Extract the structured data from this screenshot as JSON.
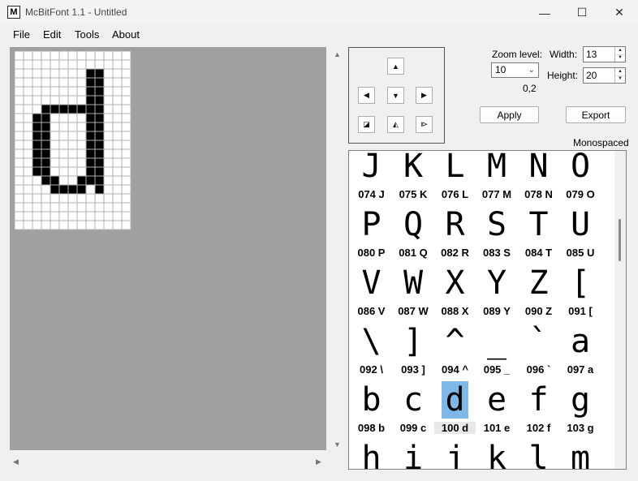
{
  "window": {
    "title": "McBitFont 1.1 - Untitled",
    "app_icon_letter": "M",
    "minimize": "—",
    "maximize": "☐",
    "close": "✕"
  },
  "menu": [
    "File",
    "Edit",
    "Tools",
    "About"
  ],
  "editor": {
    "grid_cols": 13,
    "grid_rows": 20,
    "filled_pixels": [
      [
        8,
        2
      ],
      [
        9,
        2
      ],
      [
        8,
        3
      ],
      [
        9,
        3
      ],
      [
        8,
        4
      ],
      [
        9,
        4
      ],
      [
        8,
        5
      ],
      [
        9,
        5
      ],
      [
        8,
        6
      ],
      [
        9,
        6
      ],
      [
        3,
        6
      ],
      [
        4,
        6
      ],
      [
        5,
        6
      ],
      [
        6,
        6
      ],
      [
        7,
        6
      ],
      [
        2,
        7
      ],
      [
        3,
        7
      ],
      [
        8,
        7
      ],
      [
        9,
        7
      ],
      [
        2,
        8
      ],
      [
        3,
        8
      ],
      [
        8,
        8
      ],
      [
        9,
        8
      ],
      [
        2,
        9
      ],
      [
        3,
        9
      ],
      [
        8,
        9
      ],
      [
        9,
        9
      ],
      [
        2,
        10
      ],
      [
        3,
        10
      ],
      [
        8,
        10
      ],
      [
        9,
        10
      ],
      [
        2,
        11
      ],
      [
        3,
        11
      ],
      [
        8,
        11
      ],
      [
        9,
        11
      ],
      [
        2,
        12
      ],
      [
        3,
        12
      ],
      [
        8,
        12
      ],
      [
        9,
        12
      ],
      [
        2,
        13
      ],
      [
        3,
        13
      ],
      [
        8,
        13
      ],
      [
        9,
        13
      ],
      [
        3,
        14
      ],
      [
        4,
        14
      ],
      [
        7,
        14
      ],
      [
        8,
        14
      ],
      [
        9,
        14
      ],
      [
        4,
        15
      ],
      [
        5,
        15
      ],
      [
        6,
        15
      ],
      [
        7,
        15
      ],
      [
        9,
        15
      ]
    ],
    "colors": {
      "canvas_bg": "#a0a0a0",
      "pixel_on": "#000000",
      "pixel_off": "#ffffff"
    }
  },
  "controls": {
    "zoom_label": "Zoom level:",
    "zoom_value": "10",
    "coords": "0,2",
    "width_label": "Width:",
    "width_value": "13",
    "height_label": "Height:",
    "height_value": "20",
    "apply_label": "Apply",
    "export_label": "Export",
    "mode_label": "Monospaced",
    "nav_buttons": {
      "up": "▲",
      "left": "◀",
      "down": "▼",
      "right": "▶",
      "invert": "◪",
      "flip_v": "◭",
      "flip_h": "⧐"
    }
  },
  "glyphs": [
    {
      "char": "J",
      "label": "074 J"
    },
    {
      "char": "K",
      "label": "075 K"
    },
    {
      "char": "L",
      "label": "076 L"
    },
    {
      "char": "M",
      "label": "077 M"
    },
    {
      "char": "N",
      "label": "078 N"
    },
    {
      "char": "O",
      "label": "079 O"
    },
    {
      "char": "P",
      "label": "080 P"
    },
    {
      "char": "Q",
      "label": "081 Q"
    },
    {
      "char": "R",
      "label": "082 R"
    },
    {
      "char": "S",
      "label": "083 S"
    },
    {
      "char": "T",
      "label": "084 T"
    },
    {
      "char": "U",
      "label": "085 U"
    },
    {
      "char": "V",
      "label": "086 V"
    },
    {
      "char": "W",
      "label": "087 W"
    },
    {
      "char": "X",
      "label": "088 X"
    },
    {
      "char": "Y",
      "label": "089 Y"
    },
    {
      "char": "Z",
      "label": "090 Z"
    },
    {
      "char": "[",
      "label": "091 ["
    },
    {
      "char": "\\",
      "label": "092 \\"
    },
    {
      "char": "]",
      "label": "093 ]"
    },
    {
      "char": "^",
      "label": "094 ^"
    },
    {
      "char": "_",
      "label": "095 _"
    },
    {
      "char": "`",
      "label": "096 `"
    },
    {
      "char": "a",
      "label": "097 a"
    },
    {
      "char": "b",
      "label": "098 b"
    },
    {
      "char": "c",
      "label": "099 c"
    },
    {
      "char": "d",
      "label": "100 d",
      "selected": true
    },
    {
      "char": "e",
      "label": "101 e"
    },
    {
      "char": "f",
      "label": "102 f"
    },
    {
      "char": "g",
      "label": "103 g"
    },
    {
      "char": "h",
      "label": ""
    },
    {
      "char": "i",
      "label": ""
    },
    {
      "char": "j",
      "label": ""
    },
    {
      "char": "k",
      "label": ""
    },
    {
      "char": "l",
      "label": ""
    },
    {
      "char": "m",
      "label": ""
    }
  ]
}
